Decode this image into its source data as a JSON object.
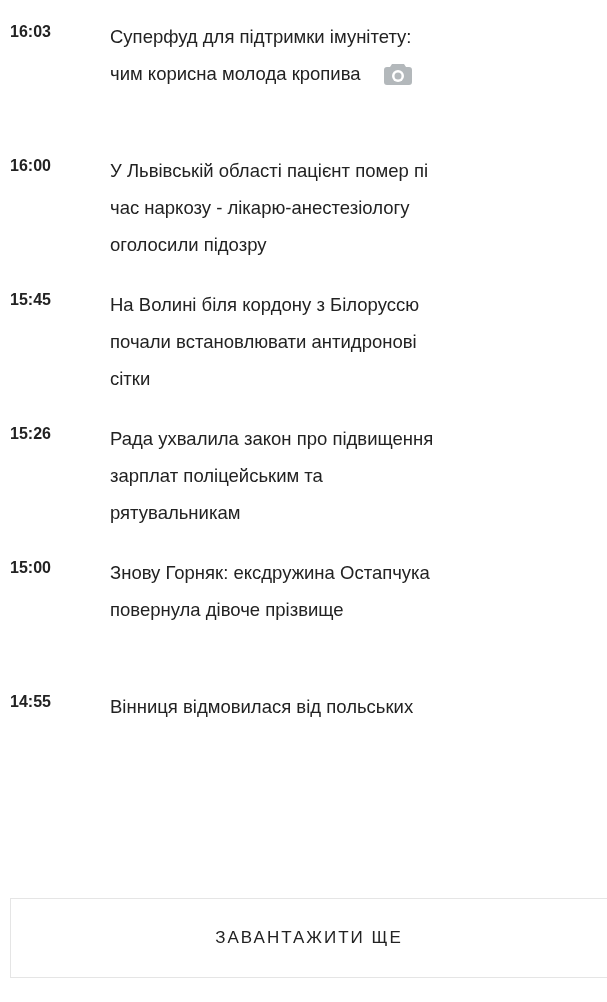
{
  "news": [
    {
      "time": "16:03",
      "lines": [
        "Суперфуд для підтримки імунітету:",
        "чим корисна молода кропива"
      ],
      "has_photo": true
    },
    {
      "time": "16:00",
      "lines": [
        "У Львівській області пацієнт помер пі",
        "час наркозу - лікарю-анестезіологу",
        "оголосили підозру"
      ],
      "has_photo": false
    },
    {
      "time": "15:45",
      "lines": [
        "На Волині біля кордону з Білоруссю",
        "почали встановлювати антидронові",
        "сітки"
      ],
      "has_photo": false
    },
    {
      "time": "15:26",
      "lines": [
        "Рада ухвалила закон про підвищення",
        "зарплат поліцейським та",
        "рятувальникам"
      ],
      "has_photo": false
    },
    {
      "time": "15:00",
      "lines": [
        "Знову Горняк: ексдружина Остапчука",
        "повернула дівоче прізвище"
      ],
      "has_photo": false
    },
    {
      "time": "14:55",
      "lines": [
        "Вінниця відмовилася від польських"
      ],
      "has_photo": false
    }
  ],
  "load_more_button": "ЗАВАНТАЖИТИ ЩЕ"
}
